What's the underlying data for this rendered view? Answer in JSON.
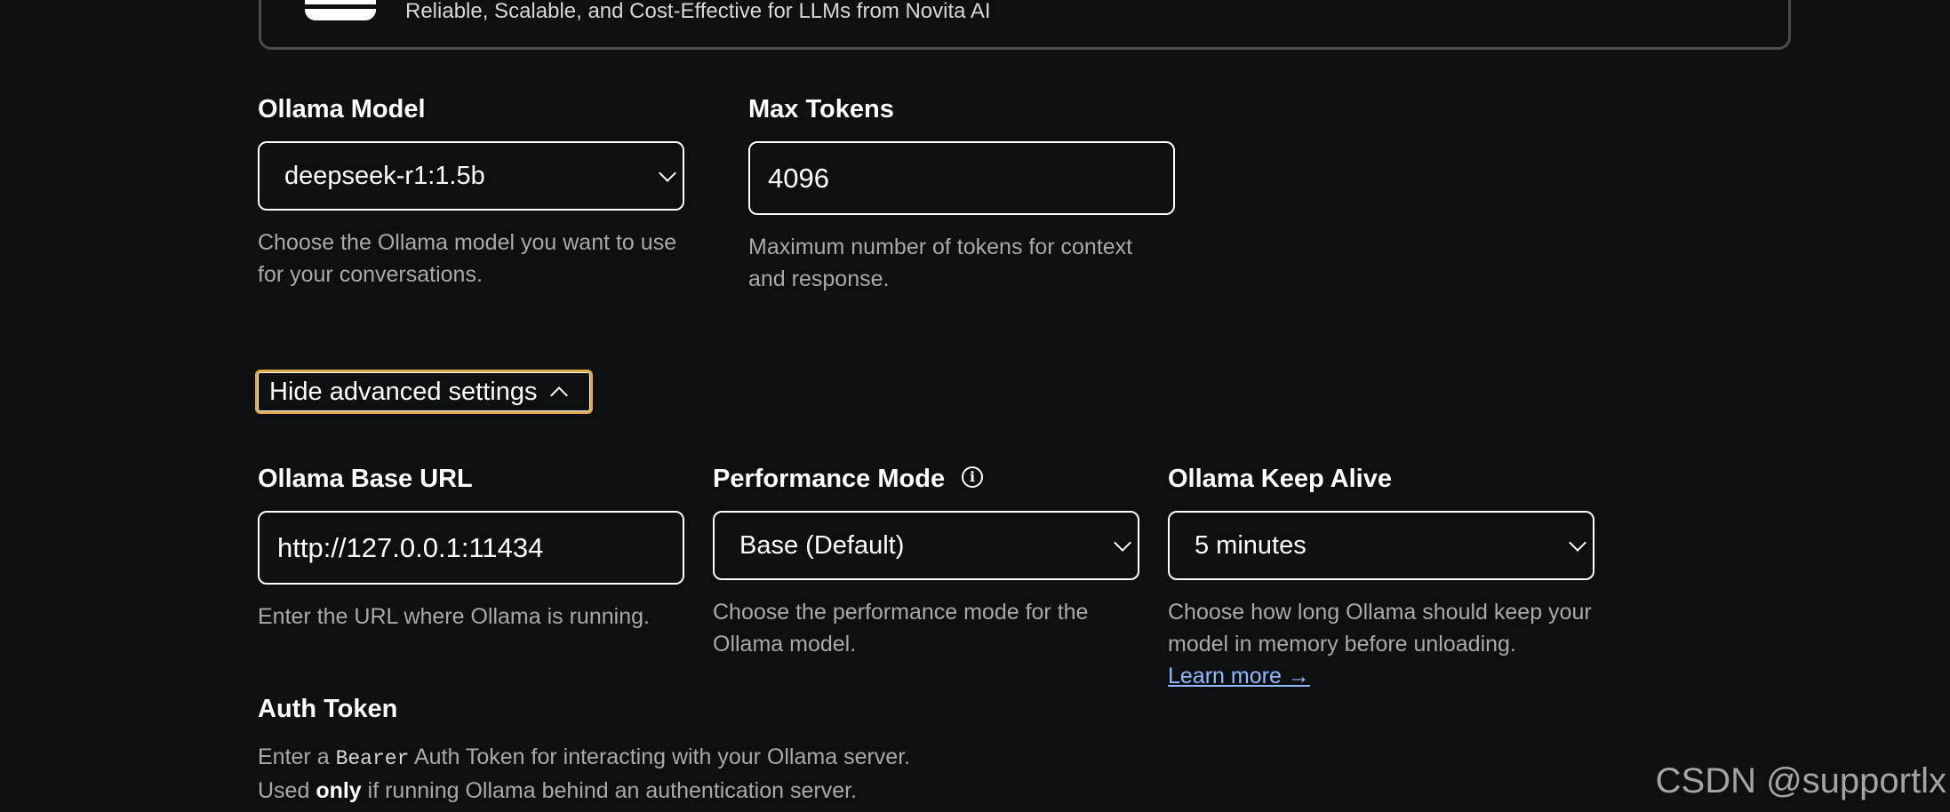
{
  "provider_card": {
    "description": "Reliable, Scalable, and Cost-Effective for LLMs from Novita AI"
  },
  "ollama_model": {
    "label": "Ollama Model",
    "value": "deepseek-r1:1.5b",
    "help": "Choose the Ollama model you want to use for your conversations."
  },
  "max_tokens": {
    "label": "Max Tokens",
    "value": "4096",
    "help": "Maximum number of tokens for context and response."
  },
  "advanced_toggle": {
    "label": "Hide advanced settings"
  },
  "base_url": {
    "label": "Ollama Base URL",
    "value": "http://127.0.0.1:11434",
    "help": "Enter the URL where Ollama is running."
  },
  "performance_mode": {
    "label": "Performance Mode",
    "value": "Base (Default)",
    "help": "Choose the performance mode for the Ollama model."
  },
  "keep_alive": {
    "label": "Ollama Keep Alive",
    "value": "5 minutes",
    "help": "Choose how long Ollama should keep your model in memory before unloading.",
    "link": "Learn more →"
  },
  "auth_token": {
    "label": "Auth Token",
    "help_prefix": "Enter a ",
    "help_code": "Bearer",
    "help_suffix": " Auth Token for interacting with your Ollama server.",
    "help2_prefix": "Used ",
    "help2_bold": "only",
    "help2_suffix": " if running Ollama behind an authentication server."
  },
  "watermark": "CSDN @supportlx"
}
